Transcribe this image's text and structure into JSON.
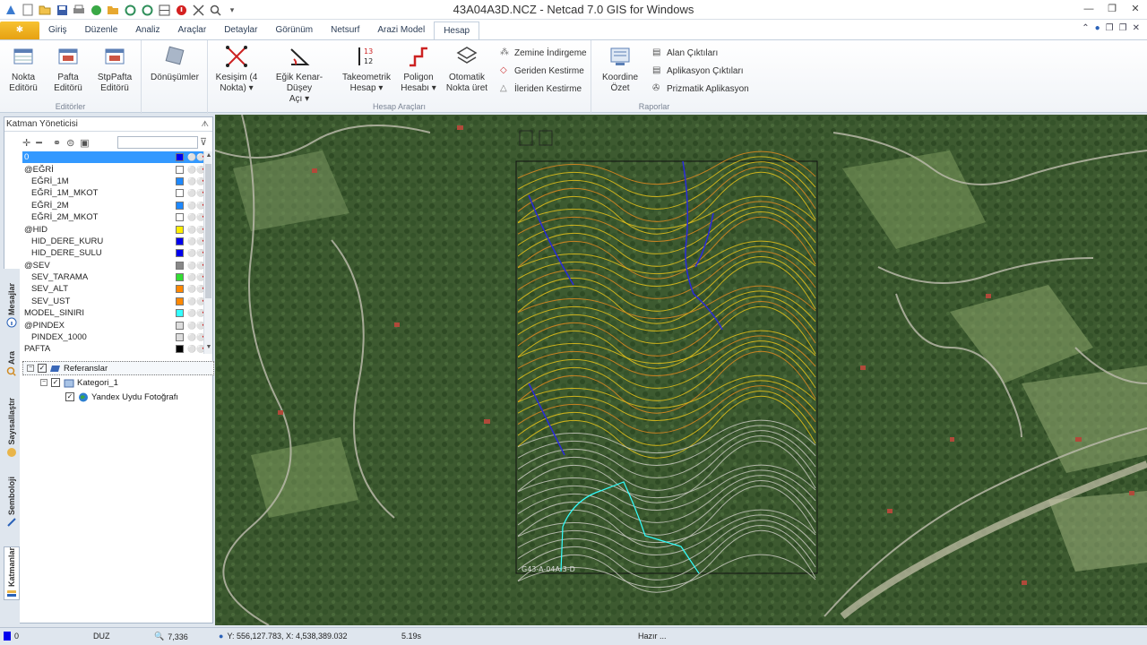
{
  "window": {
    "title": "43A04A3D.NCZ - Netcad 7.0 GIS for Windows"
  },
  "tabs": [
    {
      "label": "Giriş"
    },
    {
      "label": "Düzenle"
    },
    {
      "label": "Analiz"
    },
    {
      "label": "Araçlar"
    },
    {
      "label": "Detaylar"
    },
    {
      "label": "Görünüm"
    },
    {
      "label": "Netsurf"
    },
    {
      "label": "Arazi Model"
    },
    {
      "label": "Hesap"
    }
  ],
  "ribbon": {
    "editors": {
      "group_label": "Editörler",
      "nokta": "Nokta\nEditörü",
      "pafta": "Pafta\nEditörü",
      "stppafta": "StpPafta\nEditörü"
    },
    "donusumler": "Dönüşümler",
    "hesap": {
      "group_label": "Hesap Araçları",
      "kesisim": "Kesişim (4\nNokta) ▾",
      "egik": "Eğik Kenar-Düşey\nAçı ▾",
      "takeometrik": "Takeometrik\nHesap ▾",
      "poligon": "Poligon\nHesabı ▾",
      "otomatik": "Otomatik\nNokta üret",
      "zemine": "Zemine İndirgeme",
      "geriden": "Geriden Kestirme",
      "ileriden": "İleriden Kestirme"
    },
    "raporlar": {
      "group_label": "Raporlar",
      "koordine": "Koordine\nÖzet",
      "alan": "Alan Çıktıları",
      "aplikasyon": "Aplikasyon Çıktıları",
      "prizmatik": "Prizmatik Aplikasyon"
    }
  },
  "layer_panel": {
    "title": "Katman Yöneticisi",
    "search_placeholder": "",
    "layers": [
      {
        "name": "0",
        "color": "#0000ee",
        "indent": 0,
        "selected": true
      },
      {
        "name": "@EĞRİ",
        "color": "#ffffff",
        "indent": 0
      },
      {
        "name": "EĞRİ_1M",
        "color": "#1e88ff",
        "indent": 1
      },
      {
        "name": "EĞRİ_1M_MKOT",
        "color": "#ffffff",
        "indent": 1
      },
      {
        "name": "EĞRİ_2M",
        "color": "#1e88ff",
        "indent": 1
      },
      {
        "name": "EĞRİ_2M_MKOT",
        "color": "#ffffff",
        "indent": 1
      },
      {
        "name": "@HID",
        "color": "#ffee00",
        "indent": 0
      },
      {
        "name": "HID_DERE_KURU",
        "color": "#0000ee",
        "indent": 1
      },
      {
        "name": "HID_DERE_SULU",
        "color": "#0000ee",
        "indent": 1
      },
      {
        "name": "@SEV",
        "color": "#888888",
        "indent": 0
      },
      {
        "name": "SEV_TARAMA",
        "color": "#33dd33",
        "indent": 1
      },
      {
        "name": "SEV_ALT",
        "color": "#ff8800",
        "indent": 1
      },
      {
        "name": "SEV_UST",
        "color": "#ff8800",
        "indent": 1
      },
      {
        "name": "MODEL_SINIRI",
        "color": "#33ffff",
        "indent": 0
      },
      {
        "name": "@PINDEX",
        "color": "#dddddd",
        "indent": 0
      },
      {
        "name": "PINDEX_1000",
        "color": "#dddddd",
        "indent": 1
      },
      {
        "name": "PAFTA",
        "color": "#000000",
        "indent": 0
      }
    ],
    "tree": {
      "root": "Referanslar",
      "category": "Kategori_1",
      "item": "Yandex Uydu Fotoğrafı"
    }
  },
  "side_tabs": {
    "mesajlar": "Mesajlar",
    "ara": "Ara",
    "sayisallastir": "Sayısallaştır",
    "semboloji": "Semboloji",
    "katmanlar": "Katmanlar"
  },
  "map": {
    "sheet_label": "G43-A-04A-3-D"
  },
  "status": {
    "layer": "0",
    "mode": "DUZ",
    "zoom": "7,336",
    "coords": "Y: 556,127.783, X: 4,538,389.032",
    "time": "5.19s",
    "state": "Hazır ..."
  },
  "colors": {
    "accent": "#3399ff",
    "contour_yellow": "#e6c21a",
    "contour_orange": "#e08a1e",
    "stream": "#2a2adb",
    "model_border": "#33ffff"
  }
}
